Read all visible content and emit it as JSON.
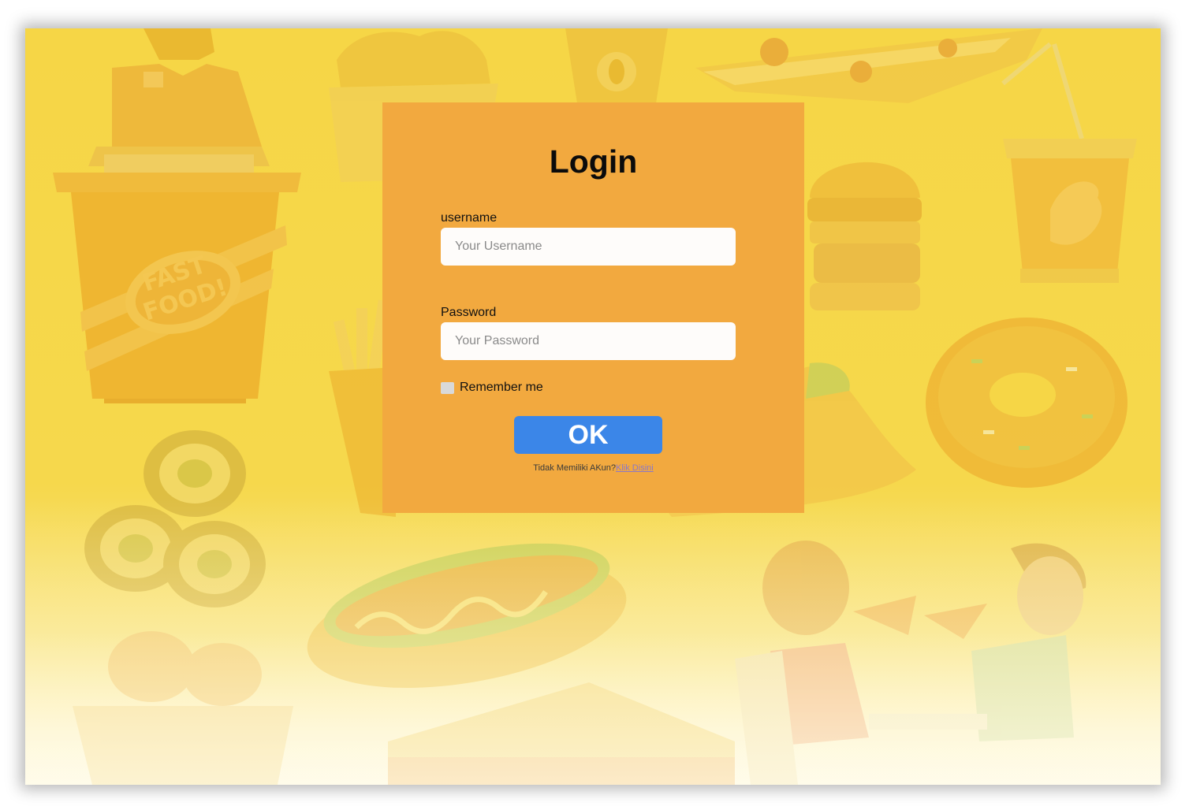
{
  "login": {
    "title": "Login",
    "username_label": "username",
    "username_placeholder": "Your Username",
    "password_label": "Password",
    "password_placeholder": "Your Password",
    "remember_label": "Remember me",
    "submit_label": "OK",
    "signup_prompt": "Tidak Memiliki AKun?",
    "signup_link": "Klik Disini"
  },
  "background": {
    "badge_line1": "FAST",
    "badge_line2": "FOOD!"
  },
  "colors": {
    "background": "#f6d646",
    "card": "#f2a93f",
    "button": "#3b86e8",
    "link": "#8a78c9"
  }
}
